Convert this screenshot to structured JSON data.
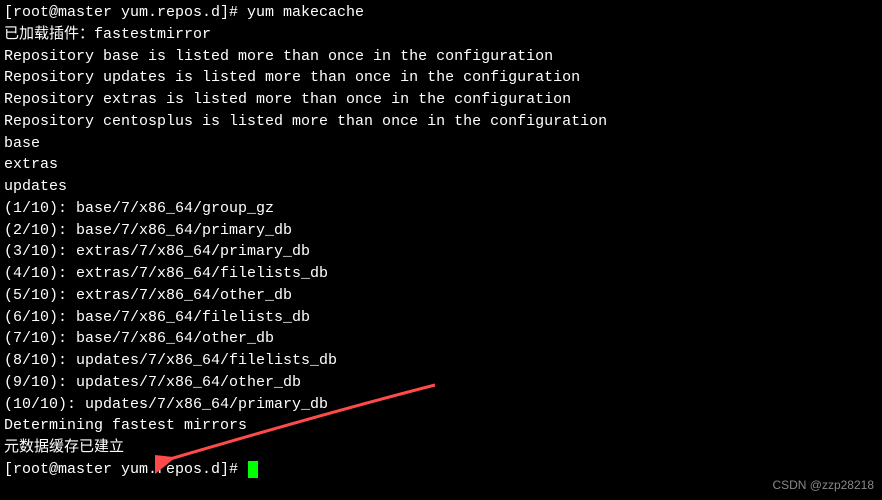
{
  "terminal": {
    "lines": [
      "[root@master yum.repos.d]# yum makecache",
      "已加载插件：fastestmirror",
      "Repository base is listed more than once in the configuration",
      "Repository updates is listed more than once in the configuration",
      "Repository extras is listed more than once in the configuration",
      "Repository centosplus is listed more than once in the configuration",
      "base",
      "extras",
      "updates",
      "(1/10): base/7/x86_64/group_gz",
      "(2/10): base/7/x86_64/primary_db",
      "(3/10): extras/7/x86_64/primary_db",
      "(4/10): extras/7/x86_64/filelists_db",
      "(5/10): extras/7/x86_64/other_db",
      "(6/10): base/7/x86_64/filelists_db",
      "(7/10): base/7/x86_64/other_db",
      "(8/10): updates/7/x86_64/filelists_db",
      "(9/10): updates/7/x86_64/other_db",
      "(10/10): updates/7/x86_64/primary_db",
      "Determining fastest mirrors",
      "元数据缓存已建立",
      "[root@master yum.repos.d]# "
    ],
    "prompt_cursor": true
  },
  "annotation": {
    "arrow_color": "#ff4a4a"
  },
  "watermark": "CSDN @zzp28218"
}
